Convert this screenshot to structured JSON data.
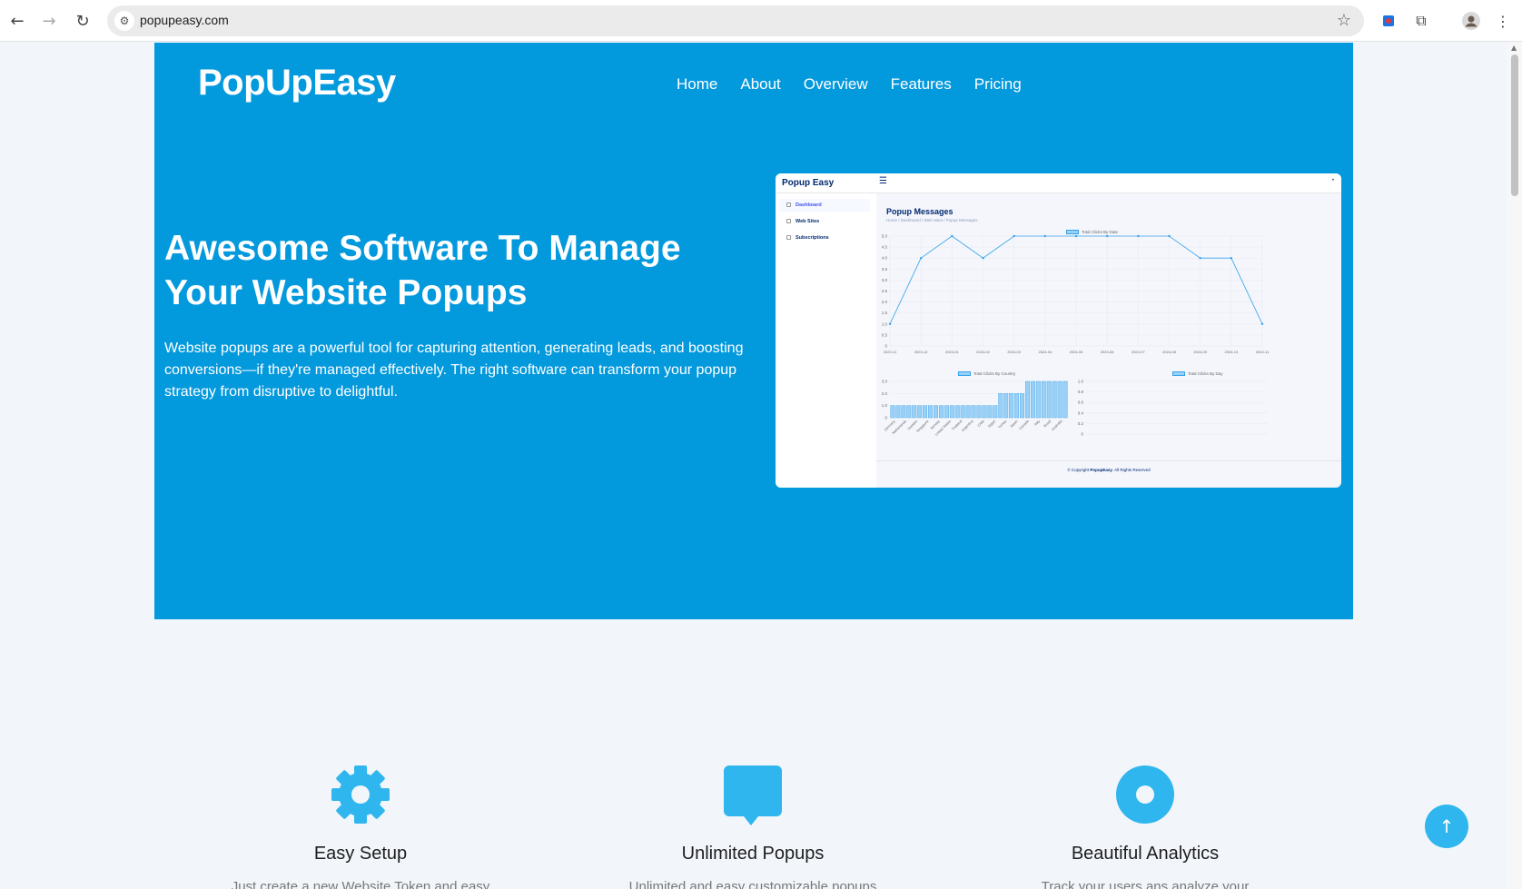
{
  "browser": {
    "url": "popupeasy.com",
    "back_icon": "←",
    "forward_icon": "→",
    "reload_icon": "↻",
    "site_info_icon": "⚙",
    "star_icon": "☆",
    "extensions_icon": "⧉",
    "menu_icon": "⋮"
  },
  "site": {
    "logo": "PopUpEasy",
    "nav": [
      "Home",
      "About",
      "Overview",
      "Features",
      "Pricing"
    ]
  },
  "hero": {
    "title": "Awesome Software To Manage Your Website Popups",
    "text": "Website popups are a powerful tool for capturing attention, generating leads, and boosting conversions—if they're managed effectively. The right software can transform your popup strategy from disruptive to delightful."
  },
  "dashboard": {
    "brand": "Popup Easy",
    "hamburger": "☰",
    "sidebar": [
      "Dashboard",
      "Web Sites",
      "Subscriptions"
    ],
    "page_title": "Popup Messages",
    "breadcrumb": "Home  /  Dashboard  /  Web Sites  /  Popup Messages",
    "footer_prefix": "© Copyright ",
    "footer_brand": "PopupEasy",
    "footer_suffix": ". All Rights Reserved"
  },
  "chart_data": [
    {
      "type": "line",
      "title": "",
      "series": [
        {
          "name": "Total Clicks By Date",
          "values": [
            1,
            4,
            5,
            4,
            5,
            5,
            5,
            5,
            5,
            5,
            4,
            4,
            1
          ]
        }
      ],
      "x": [
        "2023-11",
        "2023-12",
        "2024-01",
        "2024-02",
        "2024-03",
        "2024-04",
        "2024-05",
        "2024-06",
        "2024-07",
        "2024-08",
        "2024-09",
        "2024-10",
        "2024-11"
      ],
      "ylim": [
        0,
        5.0
      ],
      "yticks": [
        "5.0",
        "4.5",
        "4.0",
        "3.5",
        "3.0",
        "2.5",
        "2.0",
        "1.5",
        "1.0",
        "0.5",
        "0"
      ]
    },
    {
      "type": "bar",
      "series": [
        {
          "name": "Total Clicks By Country",
          "values": [
            1,
            1,
            1,
            1,
            1,
            1,
            1,
            1,
            1,
            1,
            1,
            1,
            1,
            1,
            1,
            1,
            1,
            1,
            1,
            1,
            2,
            2,
            2,
            2,
            2,
            3,
            3,
            3,
            3,
            3,
            3,
            3,
            3
          ]
        }
      ],
      "categories": [
        "Germany",
        "Netherlands",
        "Sweden",
        "Singapore",
        "Norway",
        "United States",
        "Thailand",
        "Argentina",
        "Chile",
        "Egypt",
        "Turkey",
        "Japan",
        "Canada",
        "Italy",
        "Brazil",
        "Australia"
      ],
      "ylim": [
        0,
        3.0
      ],
      "yticks": [
        "3.0",
        "2.0",
        "1.0",
        "0"
      ]
    },
    {
      "type": "bar",
      "series": [
        {
          "name": "Total Clicks By Day",
          "values": []
        }
      ],
      "ylim": [
        0,
        1.0
      ],
      "yticks": [
        "1.0",
        "0.8",
        "0.6",
        "0.4",
        "0.2",
        "0"
      ]
    }
  ],
  "features": [
    {
      "title": "Easy Setup",
      "desc": "Just create a new Website Token and easy",
      "icon": "gear-icon"
    },
    {
      "title": "Unlimited Popups",
      "desc": "Unlimited and easy customizable popups",
      "icon": "chat-bubble-icon"
    },
    {
      "title": "Beautiful Analytics",
      "desc": "Track your users ans analyze your",
      "icon": "record-icon"
    }
  ],
  "scroll_top_icon": "↑",
  "colors": {
    "hero": "#0399dd",
    "feature_icon": "#2fb6ee"
  }
}
